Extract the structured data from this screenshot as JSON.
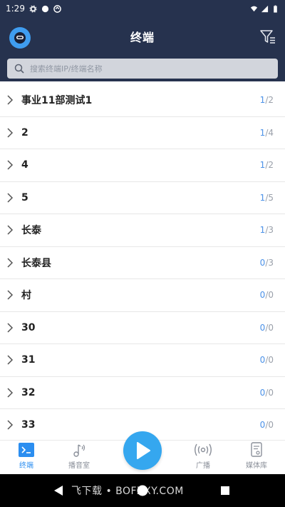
{
  "status_bar": {
    "time": "1:29"
  },
  "header": {
    "title": "终端"
  },
  "search": {
    "placeholder": "搜索终端IP/终端名称"
  },
  "groups": [
    {
      "name": "事业11部测试1",
      "online": "1",
      "total": "/2"
    },
    {
      "name": "2",
      "online": "1",
      "total": "/4"
    },
    {
      "name": "4",
      "online": "1",
      "total": "/2"
    },
    {
      "name": "5",
      "online": "1",
      "total": "/5"
    },
    {
      "name": "长泰",
      "online": "1",
      "total": "/3"
    },
    {
      "name": "长泰县",
      "online": "0",
      "total": "/3"
    },
    {
      "name": "村",
      "online": "0",
      "total": "/0"
    },
    {
      "name": "30",
      "online": "0",
      "total": "/0"
    },
    {
      "name": "31",
      "online": "0",
      "total": "/0"
    },
    {
      "name": "32",
      "online": "0",
      "total": "/0"
    },
    {
      "name": "33",
      "online": "0",
      "total": "/0"
    }
  ],
  "nav": {
    "terminal": "终端",
    "studio": "播音室",
    "broadcast": "广播",
    "media": "媒体库"
  },
  "watermark": "飞下载 • BOFZXY.COM",
  "colors": {
    "header_bg": "#26324e",
    "accent": "#2b8ef0",
    "play": "#35a7ef"
  }
}
